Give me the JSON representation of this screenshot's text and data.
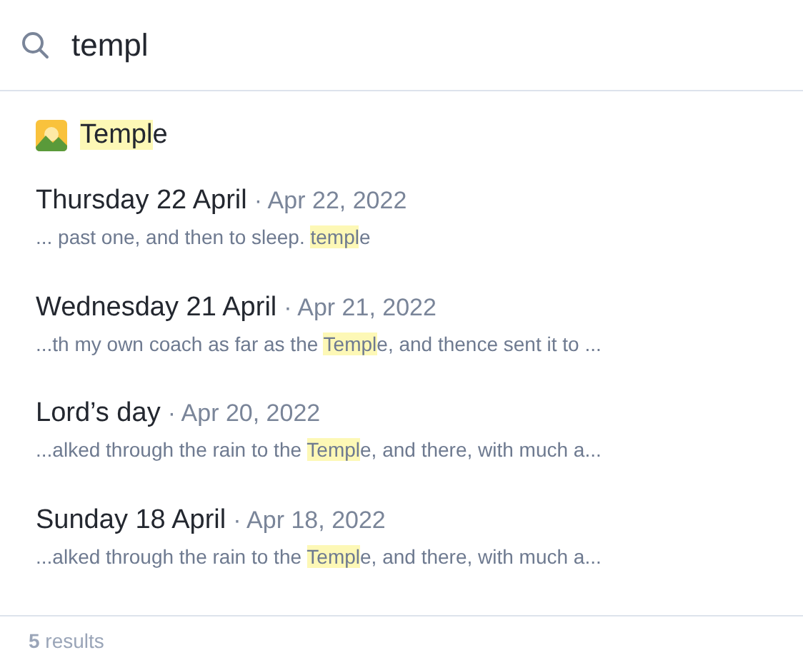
{
  "search": {
    "value": "templ"
  },
  "results": [
    {
      "kind": "page",
      "title": {
        "match": "Templ",
        "after": "e"
      }
    },
    {
      "kind": "entry",
      "title": "Thursday 22 April",
      "date": "· Apr 22, 2022",
      "snippet": {
        "before": "... past one, and then to sleep. ",
        "match": "templ",
        "after": "e"
      }
    },
    {
      "kind": "entry",
      "title": "Wednesday 21 April",
      "date": "· Apr 21, 2022",
      "snippet": {
        "before": "...th my own coach as far as the ",
        "match": "Templ",
        "after": "e, and thence sent it to ..."
      }
    },
    {
      "kind": "entry",
      "title": "Lord’s day",
      "date": "· Apr 20, 2022",
      "snippet": {
        "before": "...alked through the rain to the ",
        "match": "Templ",
        "after": "e, and there, with much a..."
      }
    },
    {
      "kind": "entry",
      "title": "Sunday 18 April",
      "date": "· Apr 18, 2022",
      "snippet": {
        "before": "...alked through the rain to the ",
        "match": "Templ",
        "after": "e, and there, with much a..."
      }
    }
  ],
  "footer": "**5** results"
}
